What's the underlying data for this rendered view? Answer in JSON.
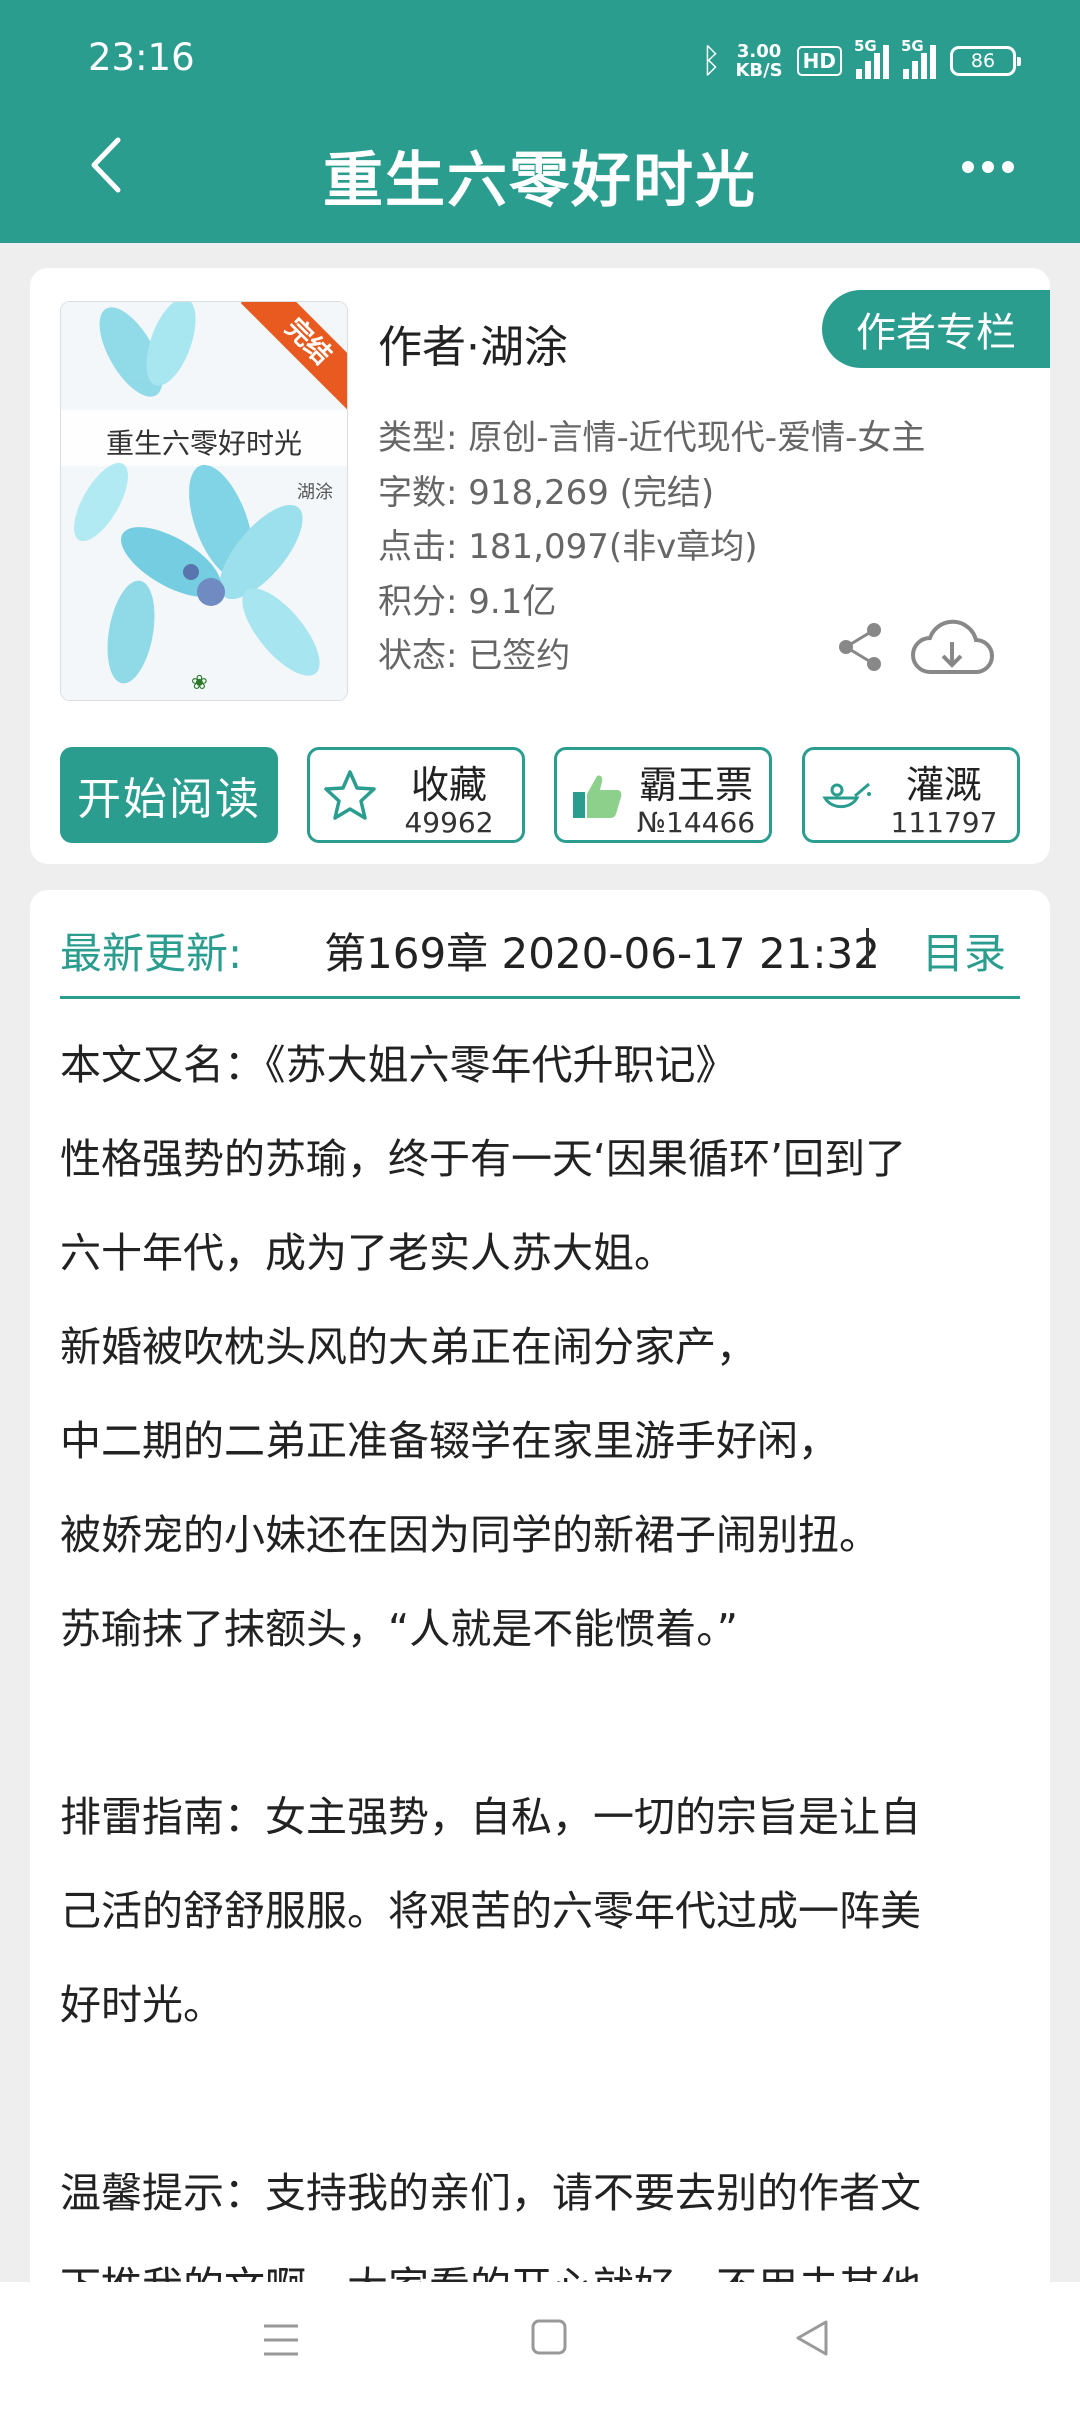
{
  "status_bar": {
    "time": "23:16",
    "net_speed_value": "3.00",
    "net_speed_unit": "KB/S",
    "hd_label": "HD",
    "signal_1_label": "5G",
    "signal_2_label": "5G",
    "battery": "86"
  },
  "header": {
    "title": "重生六零好时光"
  },
  "book": {
    "cover_title": "重生六零好时光",
    "cover_author": "湖涂",
    "cover_ribbon": "完结",
    "author": "作者·湖涂",
    "author_column_button": "作者专栏",
    "meta": [
      "类型: 原创-言情-近代现代-爱情-女主",
      "字数: 918,269 (完结)",
      "点击: 181,097(非v章均)",
      "积分: 9.1亿",
      "状态: 已签约"
    ]
  },
  "actions": {
    "read_button": "开始阅读",
    "favorite_label": "收藏",
    "favorite_count": "49962",
    "ticket_label": "霸王票",
    "ticket_count": "№14466",
    "water_label": "灌溉",
    "water_count": "111797"
  },
  "update": {
    "label": "最新更新:",
    "text": "第169章  2020-06-17 21:32",
    "toc_button": "目录"
  },
  "description": [
    "本文又名：《苏大姐六零年代升职记》",
    "性格强势的苏瑜，终于有一天‘因果循环’回到了",
    "六十年代，成为了老实人苏大姐。",
    "新婚被吹枕头风的大弟正在闹分家产，",
    "中二期的二弟正准备辍学在家里游手好闲，",
    "被娇宠的小妹还在因为同学的新裙子闹别扭。",
    "苏瑜抹了抹额头，“人就是不能惯着。”",
    "",
    "排雷指南：女主强势，自私，一切的宗旨是让自",
    "己活的舒舒服服。将艰苦的六零年代过成一阵美",
    "好时光。",
    "",
    "温馨提示：支持我的亲们，请不要去别的作者文",
    "下推我的文啊，大家看的开心就好，不用去其他"
  ],
  "colors": {
    "accent": "#2a9d8f",
    "ribbon": "#e85a1f"
  }
}
